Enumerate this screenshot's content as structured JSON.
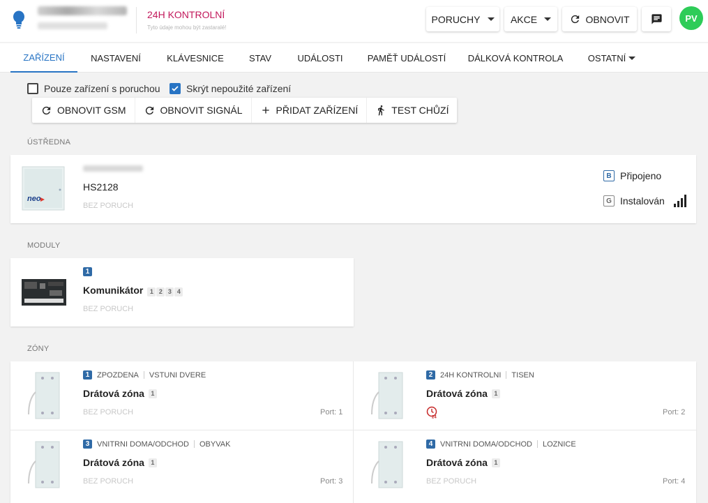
{
  "header": {
    "alert_title": "24H KONTROLNÍ",
    "alert_subtitle": "Tyto údaje mohou být zastaralé!",
    "buttons": {
      "faults": "PORUCHY",
      "actions": "AKCE",
      "refresh": "OBNOVIT"
    },
    "avatar_initials": "PV"
  },
  "tabs": [
    {
      "label": "ZAŘÍZENÍ",
      "active": true
    },
    {
      "label": "NASTAVENÍ"
    },
    {
      "label": "KLÁVESNICE"
    },
    {
      "label": "STAV"
    },
    {
      "label": "UDÁLOSTI"
    },
    {
      "label": "PAMĚŤ UDÁLOSTÍ"
    },
    {
      "label": "DÁLKOVÁ KONTROLA"
    },
    {
      "label": "OSTATNÍ"
    }
  ],
  "filters": {
    "faulty_only": {
      "label": "Pouze zařízení s poruchou",
      "checked": false
    },
    "hide_unused": {
      "label": "Skrýt nepoužité zařízení",
      "checked": true
    }
  },
  "actions": {
    "refresh_gsm": "OBNOVIT GSM",
    "refresh_signal": "OBNOVIT SIGNÁL",
    "add_device": "PŘIDAT ZAŘÍZENÍ",
    "walk_test": "TEST CHŮZÍ"
  },
  "sections": {
    "panel": "ÚSTŘEDNA",
    "modules": "MODULY",
    "zones": "ZÓNY"
  },
  "panel": {
    "model": "HS2128",
    "status": "BEZ PORUCH",
    "image_brand": "neo",
    "connection": {
      "letter": "B",
      "label": "Připojeno"
    },
    "install": {
      "letter": "G",
      "label": "Instalován"
    }
  },
  "module": {
    "number": "1",
    "name": "Komunikátor",
    "chips": [
      "1",
      "2",
      "3",
      "4"
    ],
    "status": "BEZ PORUCH"
  },
  "zones": [
    {
      "number": "1",
      "type": "ZPOZDENA",
      "location": "VSTUNI DVERE",
      "name": "Drátová zóna",
      "chip": "1",
      "status": "BEZ PORUCH",
      "port": "Port: 1"
    },
    {
      "number": "2",
      "type": "24H KONTROLNI",
      "location": "TISEN",
      "name": "Drátová zóna",
      "chip": "1",
      "status": "",
      "alarm_icon_text": "24",
      "port": "Port: 2"
    },
    {
      "number": "3",
      "type": "VNITRNI DOMA/ODCHOD",
      "location": "OBYVAK",
      "name": "Drátová zóna",
      "chip": "1",
      "status": "BEZ PORUCH",
      "port": "Port: 3"
    },
    {
      "number": "4",
      "type": "VNITRNI DOMA/ODCHOD",
      "location": "LOZNICE",
      "name": "Drátová zóna",
      "chip": "1",
      "status": "BEZ PORUCH",
      "port": "Port: 4"
    }
  ],
  "colors": {
    "accent": "#2874c4",
    "alert": "#c2185b",
    "avatar": "#2ecc58",
    "badge": "#2f6aa6"
  }
}
